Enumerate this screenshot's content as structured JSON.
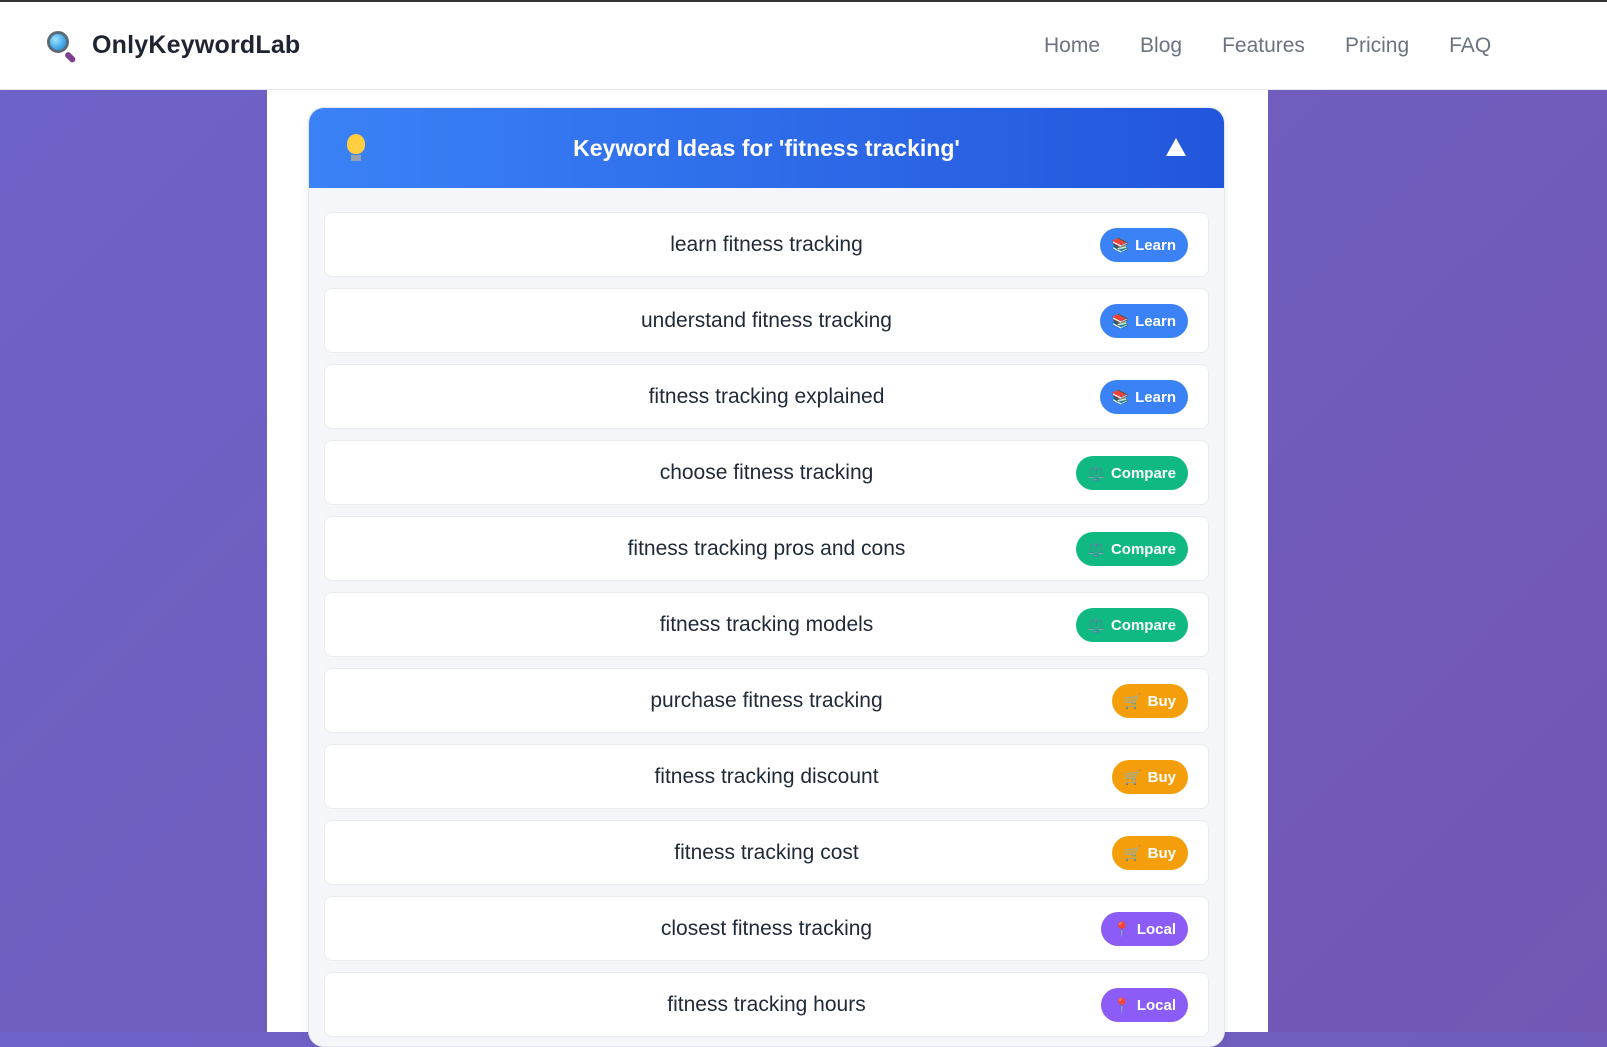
{
  "brand": {
    "name": "OnlyKeywordLab",
    "icon": "magnifier-icon"
  },
  "nav": [
    {
      "label": "Home"
    },
    {
      "label": "Blog"
    },
    {
      "label": "Features"
    },
    {
      "label": "Pricing"
    },
    {
      "label": "FAQ"
    }
  ],
  "panel": {
    "title": "Keyword Ideas for 'fitness tracking'",
    "icon": "lightbulb-icon",
    "toggle_icon": "collapse-triangle-icon"
  },
  "items": [
    {
      "text": "learn fitness tracking",
      "badge": "Learn",
      "glyph": "📚",
      "type": "learn"
    },
    {
      "text": "understand fitness tracking",
      "badge": "Learn",
      "glyph": "📚",
      "type": "learn"
    },
    {
      "text": "fitness tracking explained",
      "badge": "Learn",
      "glyph": "📚",
      "type": "learn"
    },
    {
      "text": "choose fitness tracking",
      "badge": "Compare",
      "glyph": "⚖️",
      "type": "compare"
    },
    {
      "text": "fitness tracking pros and cons",
      "badge": "Compare",
      "glyph": "⚖️",
      "type": "compare"
    },
    {
      "text": "fitness tracking models",
      "badge": "Compare",
      "glyph": "⚖️",
      "type": "compare"
    },
    {
      "text": "purchase fitness tracking",
      "badge": "Buy",
      "glyph": "🛒",
      "type": "buy"
    },
    {
      "text": "fitness tracking discount",
      "badge": "Buy",
      "glyph": "🛒",
      "type": "buy"
    },
    {
      "text": "fitness tracking cost",
      "badge": "Buy",
      "glyph": "🛒",
      "type": "buy"
    },
    {
      "text": "closest fitness tracking",
      "badge": "Local",
      "glyph": "📍",
      "type": "local"
    },
    {
      "text": "fitness tracking hours",
      "badge": "Local",
      "glyph": "📍",
      "type": "local"
    }
  ],
  "colors": {
    "learn": "#3b82f6",
    "compare": "#10b981",
    "buy": "#f59e0b",
    "local": "#8b5cf6",
    "header_gradient_start": "#3b82f6",
    "header_gradient_end": "#2256dc"
  }
}
